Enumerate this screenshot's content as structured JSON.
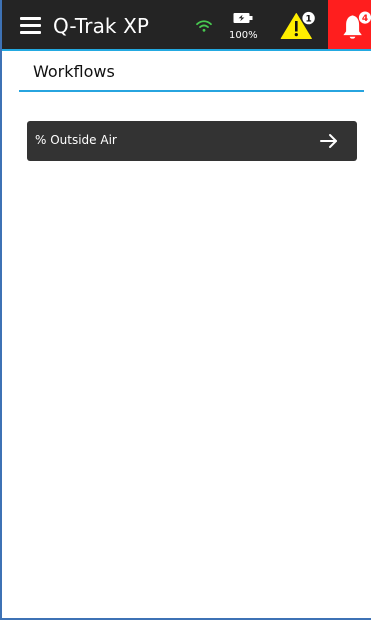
{
  "header": {
    "app_title": "Q-Trak XP",
    "battery_label": "100%",
    "battery_level_percent": 100,
    "warning_count": "1",
    "alert_count": "4",
    "icons": {
      "menu": "hamburger-menu-icon",
      "wifi": "wifi-icon",
      "battery": "battery-charging-icon",
      "warning": "warning-triangle-icon",
      "alert": "bell-icon"
    },
    "colors": {
      "background": "#242424",
      "wifi": "#48c850",
      "warning": "#ffee00",
      "alert_background": "#ff1e1e",
      "accent": "#23a9e1"
    }
  },
  "main": {
    "section_title": "Workflows",
    "workflows": [
      {
        "label": "% Outside Air",
        "icon": "arrow-right-icon"
      }
    ]
  }
}
